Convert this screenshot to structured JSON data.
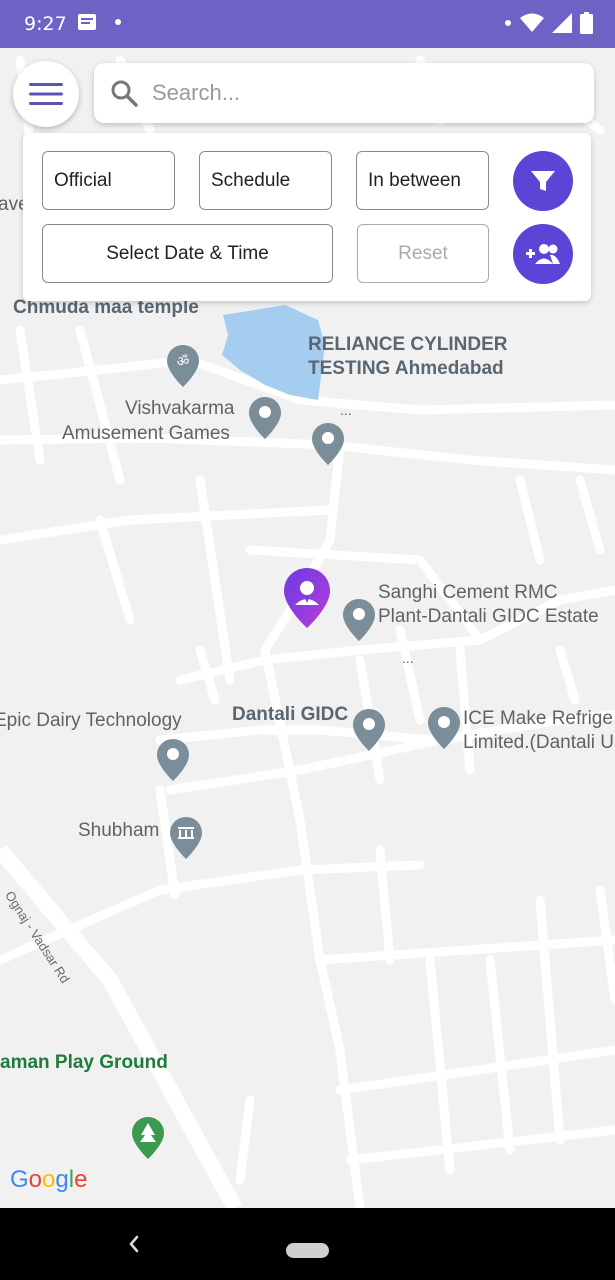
{
  "status_bar": {
    "time": "9:27",
    "background_color": "#6e63c5",
    "left_icons": [
      "notes-icon",
      "dot-icon"
    ],
    "right_icons": [
      "dot-icon",
      "wifi-icon",
      "signal-icon",
      "battery-icon"
    ]
  },
  "search": {
    "placeholder": "Search...",
    "value": ""
  },
  "filters": {
    "official_label": "Official",
    "schedule_label": "Schedule",
    "between_label": "In between",
    "date_time_label": "Select Date & Time",
    "reset_label": "Reset",
    "accent_color": "#5a45d6"
  },
  "map": {
    "labels": {
      "chmuda": "Chmuda maa temple",
      "reliance_line1": "RELIANCE CYLINDER",
      "reliance_line2": "TESTING Ahmedabad",
      "reliance_more": "...",
      "vishvakarma_line1": "Vishvakarma",
      "vishvakarma_line2": "Amusement Games",
      "sanghi_line1": "Sanghi Cement RMC",
      "sanghi_line2": "Plant-Dantali GIDC Estate",
      "sanghi_more": "...",
      "epic": "Epic Dairy Technology",
      "dantali": "Dantali GIDC",
      "ice_line1": "ICE Make Refrige",
      "ice_line2": "Limited.(Dantali U",
      "shubham": "Shubham",
      "road": "Ognaj - Vadsar Rd",
      "playground": "aman Play Ground",
      "left_edge": "ave"
    },
    "google_logo": "Google"
  },
  "nav_bar": {
    "icons": [
      "back-icon",
      "home-pill-icon"
    ]
  }
}
